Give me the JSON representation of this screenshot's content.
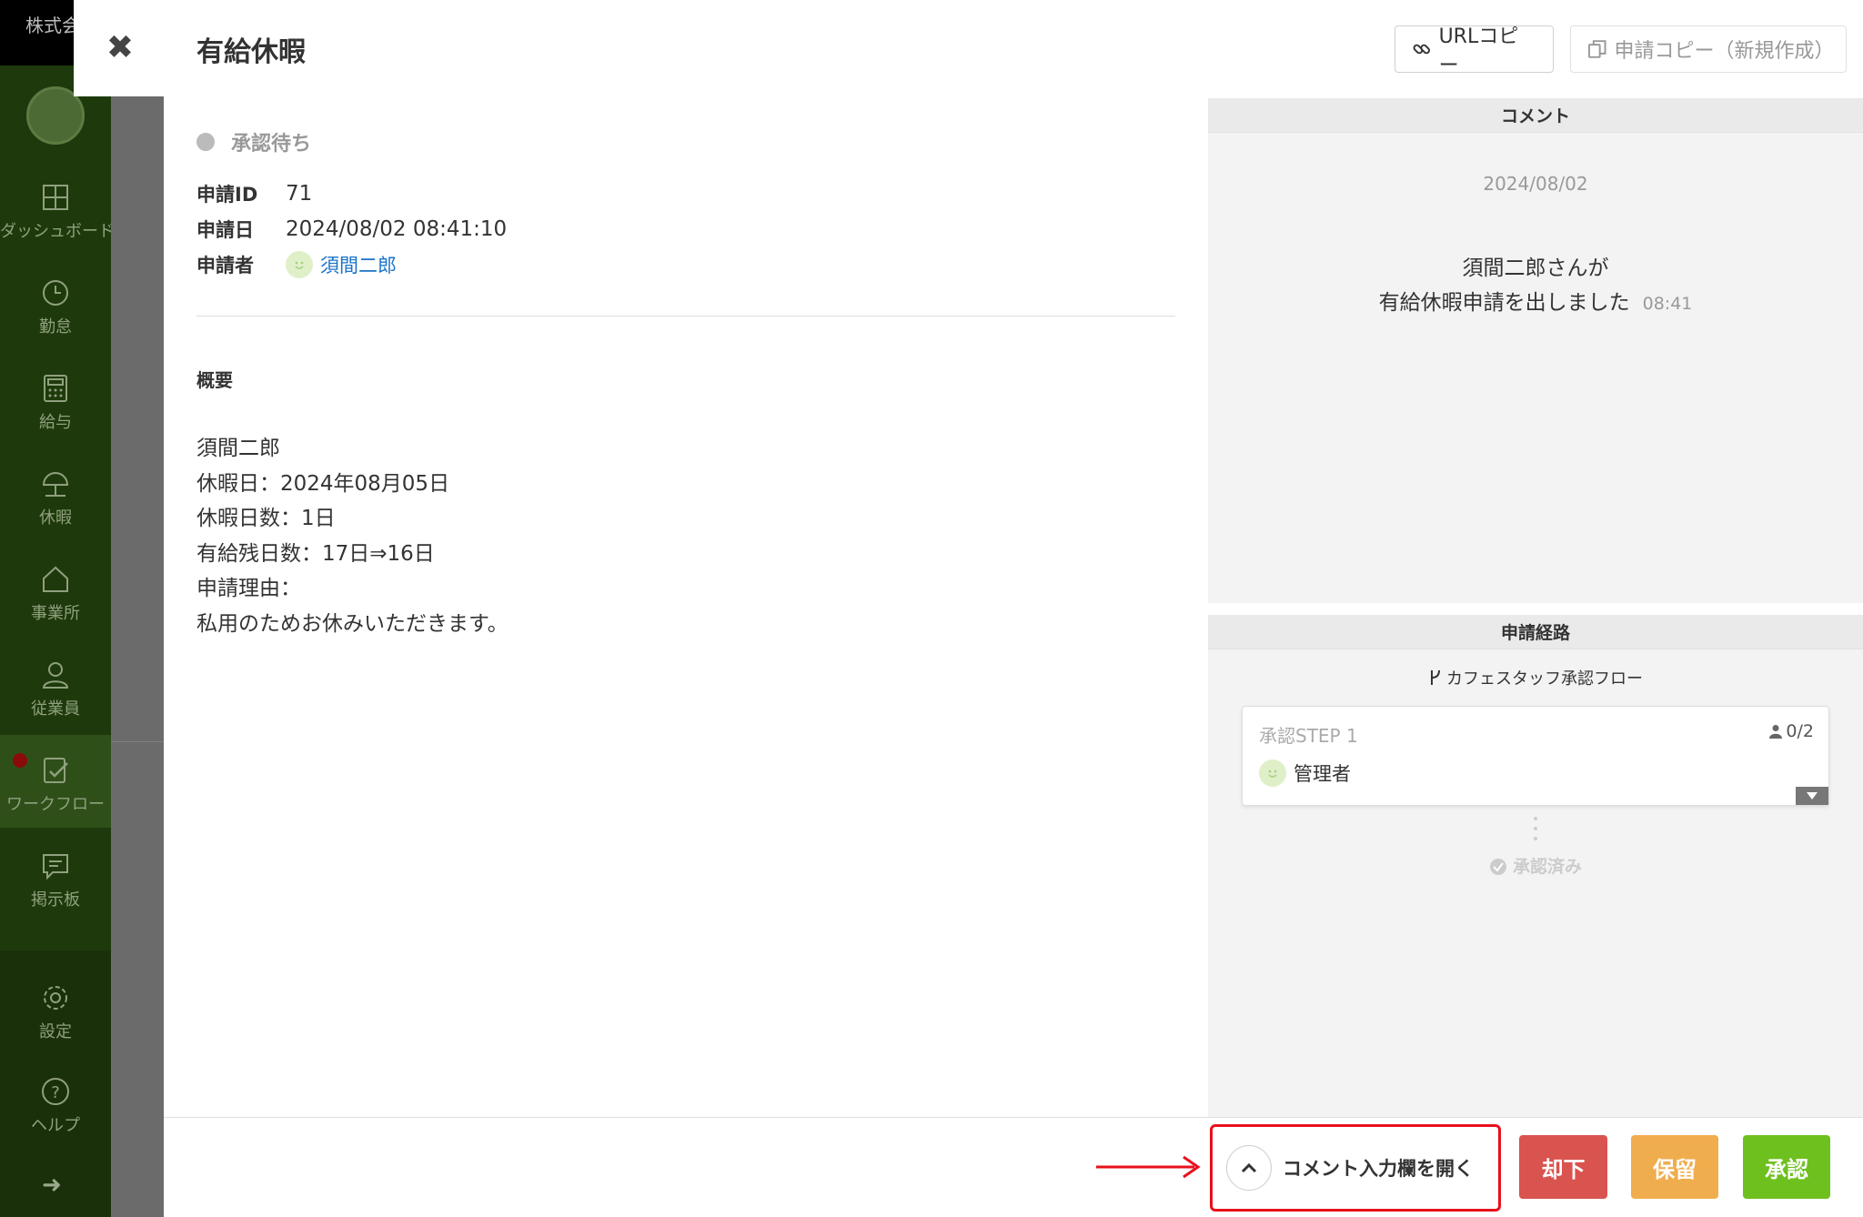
{
  "background": {
    "company": "株式会",
    "nav": [
      {
        "label": "ダッシュボード",
        "icon": "dashboard-icon"
      },
      {
        "label": "勤怠",
        "icon": "clock-icon"
      },
      {
        "label": "給与",
        "icon": "calculator-icon"
      },
      {
        "label": "休暇",
        "icon": "umbrella-icon"
      },
      {
        "label": "事業所",
        "icon": "home-icon"
      },
      {
        "label": "従業員",
        "icon": "person-icon"
      },
      {
        "label": "ワークフロー",
        "icon": "workflow-icon"
      },
      {
        "label": "掲示板",
        "icon": "message-icon"
      },
      {
        "label": "設定",
        "icon": "gear-icon"
      },
      {
        "label": "ヘルプ",
        "icon": "help-icon"
      }
    ]
  },
  "modal": {
    "title": "有給休暇",
    "url_copy_label": "URLコピー",
    "app_copy_label": "申請コピー（新規作成）"
  },
  "detail": {
    "status": "承認待ち",
    "fields": [
      {
        "key": "申請ID",
        "value": "71"
      },
      {
        "key": "申請日",
        "value": "2024/08/02 08:41:10"
      },
      {
        "key": "申請者",
        "value": "須間二郎"
      }
    ],
    "summary_label": "概要",
    "summary_lines": [
      "須間二郎",
      "休暇日：2024年08月05日",
      "休暇日数：1日",
      "有給残日数：17日⇒16日",
      "申請理由：",
      "私用のためお休みいただきます。"
    ]
  },
  "comments": {
    "header": "コメント",
    "date": "2024/08/02",
    "message_line1": "須間二郎さんが",
    "message_line2": "有給休暇申請を出しました",
    "time": "08:41"
  },
  "route": {
    "header": "申請経路",
    "flow_name": "カフェスタッフ承認フロー",
    "step_title": "承認STEP 1",
    "step_count": "0/2",
    "approver": "管理者",
    "approved_label": "承認済み"
  },
  "footer": {
    "open_comment_label": "コメント入力欄を開く",
    "reject_label": "却下",
    "hold_label": "保留",
    "approve_label": "承認"
  },
  "colors": {
    "reject": "#d9534f",
    "hold": "#f0ad4e",
    "approve": "#6ec01e",
    "annotation": "#e8101c",
    "link": "#1a73c9"
  }
}
